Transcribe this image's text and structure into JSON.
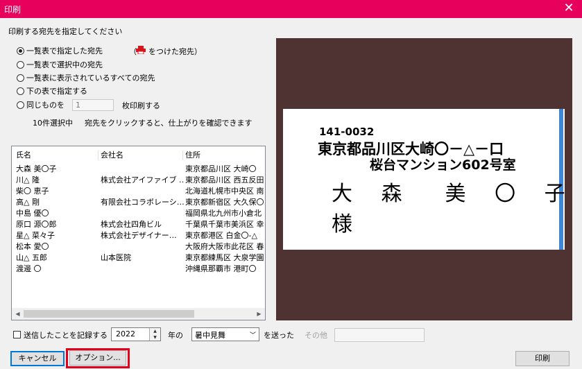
{
  "window": {
    "title": "印刷",
    "close_glyph": "✕"
  },
  "instruction": "印刷する宛先を指定してください",
  "options": [
    {
      "label": "一覧表で指定した宛先",
      "selected": true
    },
    {
      "label": "一覧表で選択中の宛先",
      "selected": false
    },
    {
      "label": "一覧表に表示されているすべての宛先",
      "selected": false
    },
    {
      "label": "下の表で指定する",
      "selected": false
    },
    {
      "label": "同じものを",
      "selected": false
    }
  ],
  "marked_hint": {
    "open": "（",
    "text": "をつけた宛先）",
    "icon": "printer-icon",
    "icon_color": "#d8141c"
  },
  "copies": {
    "value": "1",
    "suffix": "枚印刷する"
  },
  "selection_info": {
    "count": "10件選択中",
    "hint": "宛先をクリックすると、仕上がりを確認できます"
  },
  "table": {
    "headers": [
      "氏名",
      "会社名",
      "住所"
    ],
    "rows": [
      [
        "大森 美〇子",
        "",
        "東京都品川区 大崎〇"
      ],
      [
        "川△ 隆",
        "株式会社アイファイブ …",
        "東京都品川区 西五反田"
      ],
      [
        "柴〇 恵子",
        "",
        "北海道札幌市中央区 南"
      ],
      [
        "高△ 剛",
        "有限会社コラボレーシ…",
        "東京都新宿区 大久保〇"
      ],
      [
        "中島 優〇",
        "",
        "福岡県北九州市小倉北"
      ],
      [
        "原口 源〇郎",
        "株式会社四角ビル",
        "千葉県千葉市美浜区 幸"
      ],
      [
        "星△ 菜々子",
        "株式会社デザイナー…",
        "東京都港区 白金〇-△"
      ],
      [
        "松本 愛〇",
        "",
        "大阪府大阪市此花区 春"
      ],
      [
        "山△ 五郎",
        "山本医院",
        "東京都練馬区 大泉学園"
      ],
      [
        "渡邊 〇",
        "",
        "沖縄県那覇市 港町〇"
      ]
    ]
  },
  "preview": {
    "postal_code": "141-0032",
    "address_line1": "東京都品川区大崎〇－△－口",
    "address_line2": "桜台マンション602号室",
    "recipient": "大 森　美 〇 子　様",
    "background": "#4f3232",
    "accent_bar": "#3e86d6"
  },
  "record": {
    "label": "送信したことを記録する",
    "year": "2022",
    "year_suffix": "年の",
    "type": "暑中見舞",
    "sent_suffix": "を送った",
    "other_label": "その他"
  },
  "buttons": {
    "cancel": "キャンセル",
    "options": "オプション...",
    "print": "印刷"
  },
  "colors": {
    "titlebar": "#e8005d",
    "highlight": "#e3001b"
  }
}
